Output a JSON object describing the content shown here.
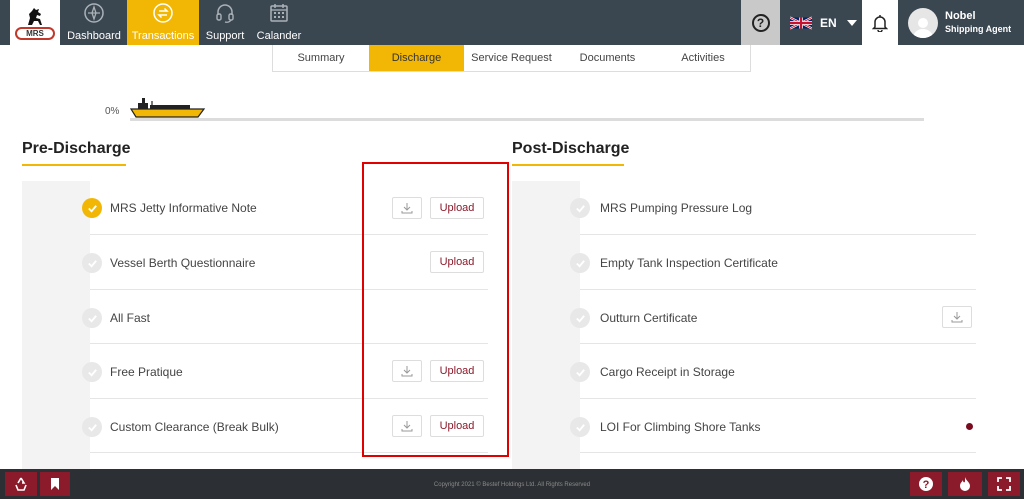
{
  "nav": {
    "logo_text": "MRS",
    "items": [
      {
        "label": "Dashboard",
        "icon": "compass-icon"
      },
      {
        "label": "Transactions",
        "icon": "exchange-icon"
      },
      {
        "label": "Support",
        "icon": "headset-icon"
      },
      {
        "label": "Calander",
        "icon": "calendar-icon"
      }
    ],
    "active": "Transactions",
    "lang": "EN",
    "user": {
      "name": "Nobel",
      "role": "Shipping Agent"
    }
  },
  "tabs": {
    "items": [
      "Summary",
      "Discharge",
      "Service Request",
      "Documents",
      "Activities"
    ],
    "active": "Discharge"
  },
  "progress": {
    "percent_label": "0%",
    "value": 0
  },
  "pre_discharge": {
    "title": "Pre-Discharge",
    "rows": [
      {
        "label": "MRS Jetty Informative Note",
        "done": true,
        "download": true,
        "upload": "Upload"
      },
      {
        "label": "Vessel Berth Questionnaire",
        "done": false,
        "download": false,
        "upload": "Upload"
      },
      {
        "label": "All Fast",
        "done": false,
        "download": false,
        "upload": ""
      },
      {
        "label": "Free Pratique",
        "done": false,
        "download": true,
        "upload": "Upload"
      },
      {
        "label": "Custom Clearance (Break Bulk)",
        "done": false,
        "download": true,
        "upload": "Upload"
      }
    ]
  },
  "post_discharge": {
    "title": "Post-Discharge",
    "rows": [
      {
        "label": "MRS Pumping Pressure Log",
        "done": false,
        "download": false,
        "dot": false
      },
      {
        "label": "Empty Tank Inspection Certificate",
        "done": false,
        "download": false,
        "dot": false
      },
      {
        "label": "Outturn Certificate",
        "done": false,
        "download": true,
        "dot": false
      },
      {
        "label": "Cargo Receipt in Storage",
        "done": false,
        "download": false,
        "dot": false
      },
      {
        "label": "LOI For Climbing Shore Tanks",
        "done": false,
        "download": false,
        "dot": true
      }
    ]
  },
  "footer": {
    "copyright": "Copyright 2021 © Bestef Holdings Ltd. All Rights Reserved"
  },
  "colors": {
    "accent": "#f2b705",
    "nav_bg": "#3a4650",
    "brand_red": "#8b1a2b",
    "highlight_box": "#e00000"
  }
}
